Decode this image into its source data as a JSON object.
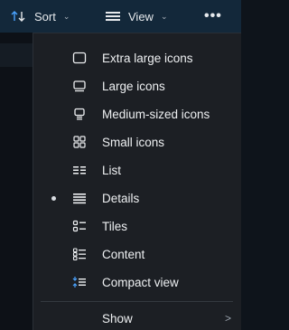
{
  "toolbar": {
    "sort_label": "Sort",
    "view_label": "View",
    "more_label": "•••"
  },
  "menu": {
    "items": [
      {
        "label": "Extra large icons",
        "icon": "extra-large-icons-icon",
        "selected": false
      },
      {
        "label": "Large icons",
        "icon": "large-icons-icon",
        "selected": false
      },
      {
        "label": "Medium-sized icons",
        "icon": "medium-icons-icon",
        "selected": false
      },
      {
        "label": "Small icons",
        "icon": "small-icons-icon",
        "selected": false
      },
      {
        "label": "List",
        "icon": "list-icon",
        "selected": false
      },
      {
        "label": "Details",
        "icon": "details-icon",
        "selected": true
      },
      {
        "label": "Tiles",
        "icon": "tiles-icon",
        "selected": false
      },
      {
        "label": "Content",
        "icon": "content-icon",
        "selected": false
      },
      {
        "label": "Compact view",
        "icon": "compact-view-icon",
        "selected": false
      },
      {
        "label": "Show",
        "icon": "",
        "selected": false,
        "submenu": true
      }
    ],
    "submenu_arrow": ">"
  },
  "colors": {
    "toolbar_bg": "#13283a",
    "menu_bg": "#1c1f24",
    "text": "#eef0f2",
    "accent_blue": "#4aa3ff"
  }
}
